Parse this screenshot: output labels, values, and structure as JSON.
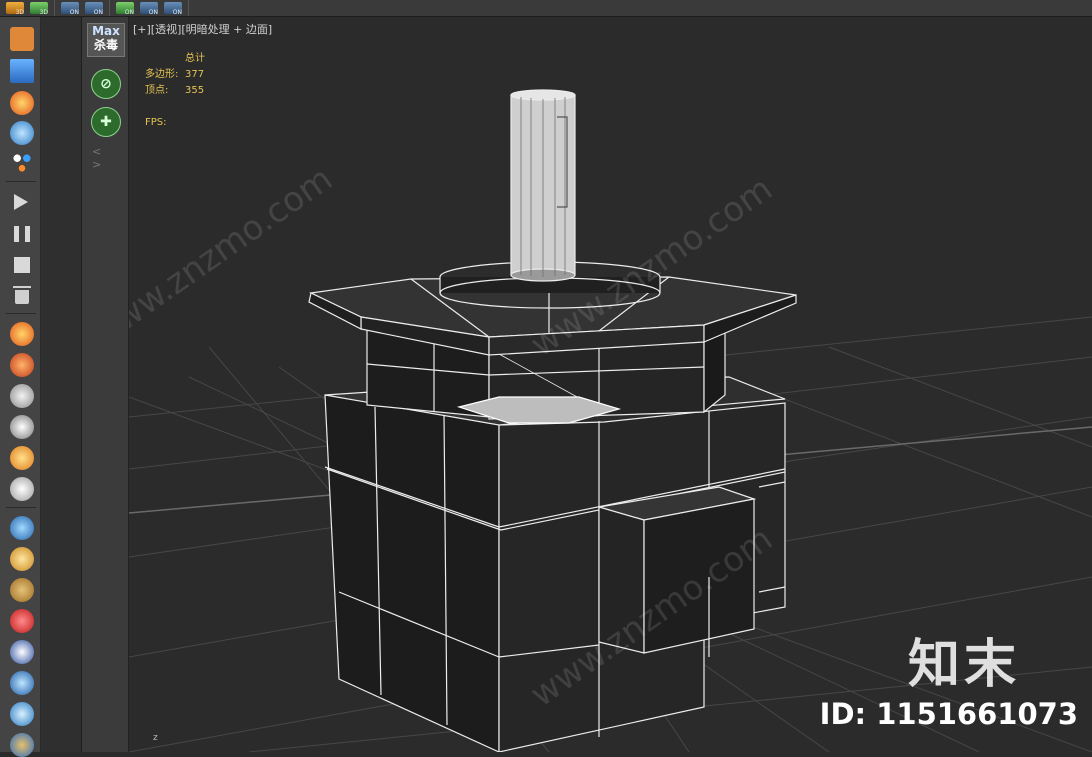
{
  "toolbar": {
    "buttons": [
      {
        "icon": "orange-3d-icon",
        "sub": "3D",
        "color": "#e89a2a"
      },
      {
        "icon": "green-3d-icon",
        "sub": "3D",
        "color": "#4caf50"
      },
      {
        "icon": "blue-undo-icon",
        "sub": "ON",
        "color": "#3d6fa6"
      },
      {
        "icon": "blue-redo-icon",
        "sub": "ON",
        "color": "#3d6fa6"
      },
      {
        "icon": "green-layer-icon",
        "sub": "ON",
        "color": "#4caf50"
      },
      {
        "icon": "blue-layer-icon",
        "sub": "ON",
        "color": "#3d6fa6"
      },
      {
        "icon": "blue-layer2-icon",
        "sub": "ON",
        "color": "#3d6fa6"
      }
    ]
  },
  "left_tools": [
    "torch-icon",
    "water-grid-icon",
    "fire-icon",
    "water-drop-icon",
    "particles-icon",
    "play-icon",
    "pause-icon",
    "stop-icon",
    "trash-icon",
    "fire-effect-icon",
    "explosion-icon",
    "smoke-icon",
    "wind-icon",
    "flame-icon",
    "dust-icon",
    "liquid-icon",
    "bucket-icon",
    "sand-icon",
    "splash-icon",
    "cloth-icon",
    "swirl-icon",
    "wave-icon"
  ],
  "plugin": {
    "title": "Max",
    "subtitle": "杀毒",
    "arrows": "< >"
  },
  "viewport": {
    "label": "[+][透视][明暗处理 + 边面]",
    "stats_header": "总计",
    "polys_label": "多边形:",
    "polys_value": "377",
    "verts_label": "顶点:",
    "verts_value": "355",
    "fps_label": "FPS:",
    "axis_label": "z"
  },
  "watermark": {
    "logo": "知末",
    "id": "ID: 1151661073",
    "diag": "www.znzmo.com"
  },
  "colors": {
    "wire": "#e8e8e8",
    "stats": "#e4c352",
    "bg": "#2b2b2b",
    "grid": "#4a4a4a"
  }
}
